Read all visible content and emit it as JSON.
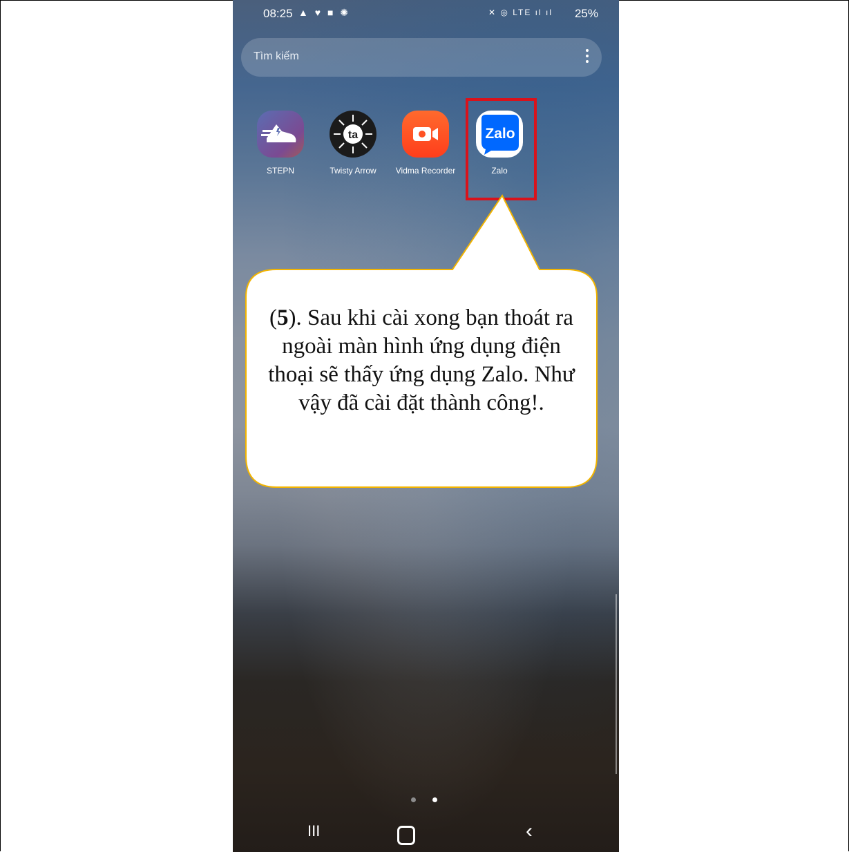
{
  "status_bar": {
    "time": "08:25",
    "left_icons": "▲ ♥ ■ ✺",
    "right_icons": "✕ ◎ LTE ıl ıl",
    "battery": "25%"
  },
  "search": {
    "placeholder": "Tìm kiếm"
  },
  "apps": [
    {
      "label": "STEPN",
      "icon": "stepn-icon"
    },
    {
      "label": "Twisty Arrow",
      "icon": "twisty-arrow-icon",
      "glyph": "ta"
    },
    {
      "label": "Vidma Recorder",
      "icon": "vidma-recorder-icon"
    },
    {
      "label": "Zalo",
      "icon": "zalo-icon",
      "glyph": "Zalo"
    }
  ],
  "callout": {
    "step": "5",
    "text_after_step": "). Sau khi cài xong bạn thoát ra ngoài màn hình ứng dụng điện thoại sẽ thấy ứng dụng Zalo. Như vậy đã cài đặt thành công!."
  },
  "page_indicator": {
    "pages": 2,
    "current": 2
  },
  "nav": {
    "recents": "III",
    "back": "‹"
  },
  "colors": {
    "highlight": "#d9121b",
    "callout_border": "#f2b400",
    "zalo_blue": "#0068ff"
  }
}
